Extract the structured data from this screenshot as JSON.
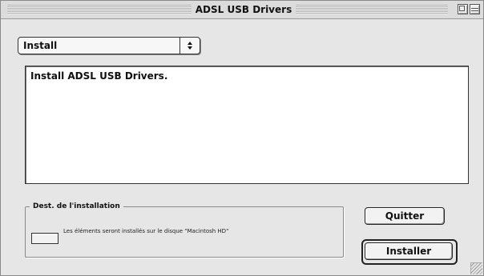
{
  "window": {
    "title": "ADSL USB Drivers"
  },
  "popup": {
    "selected": "Install"
  },
  "textarea": {
    "content": "Install ADSL USB Drivers."
  },
  "destination": {
    "legend": "Dest. de l'installation",
    "message": "Les éléments seront installés sur le disque \"Macintosh HD\""
  },
  "buttons": {
    "quit": "Quitter",
    "install": "Installer"
  }
}
